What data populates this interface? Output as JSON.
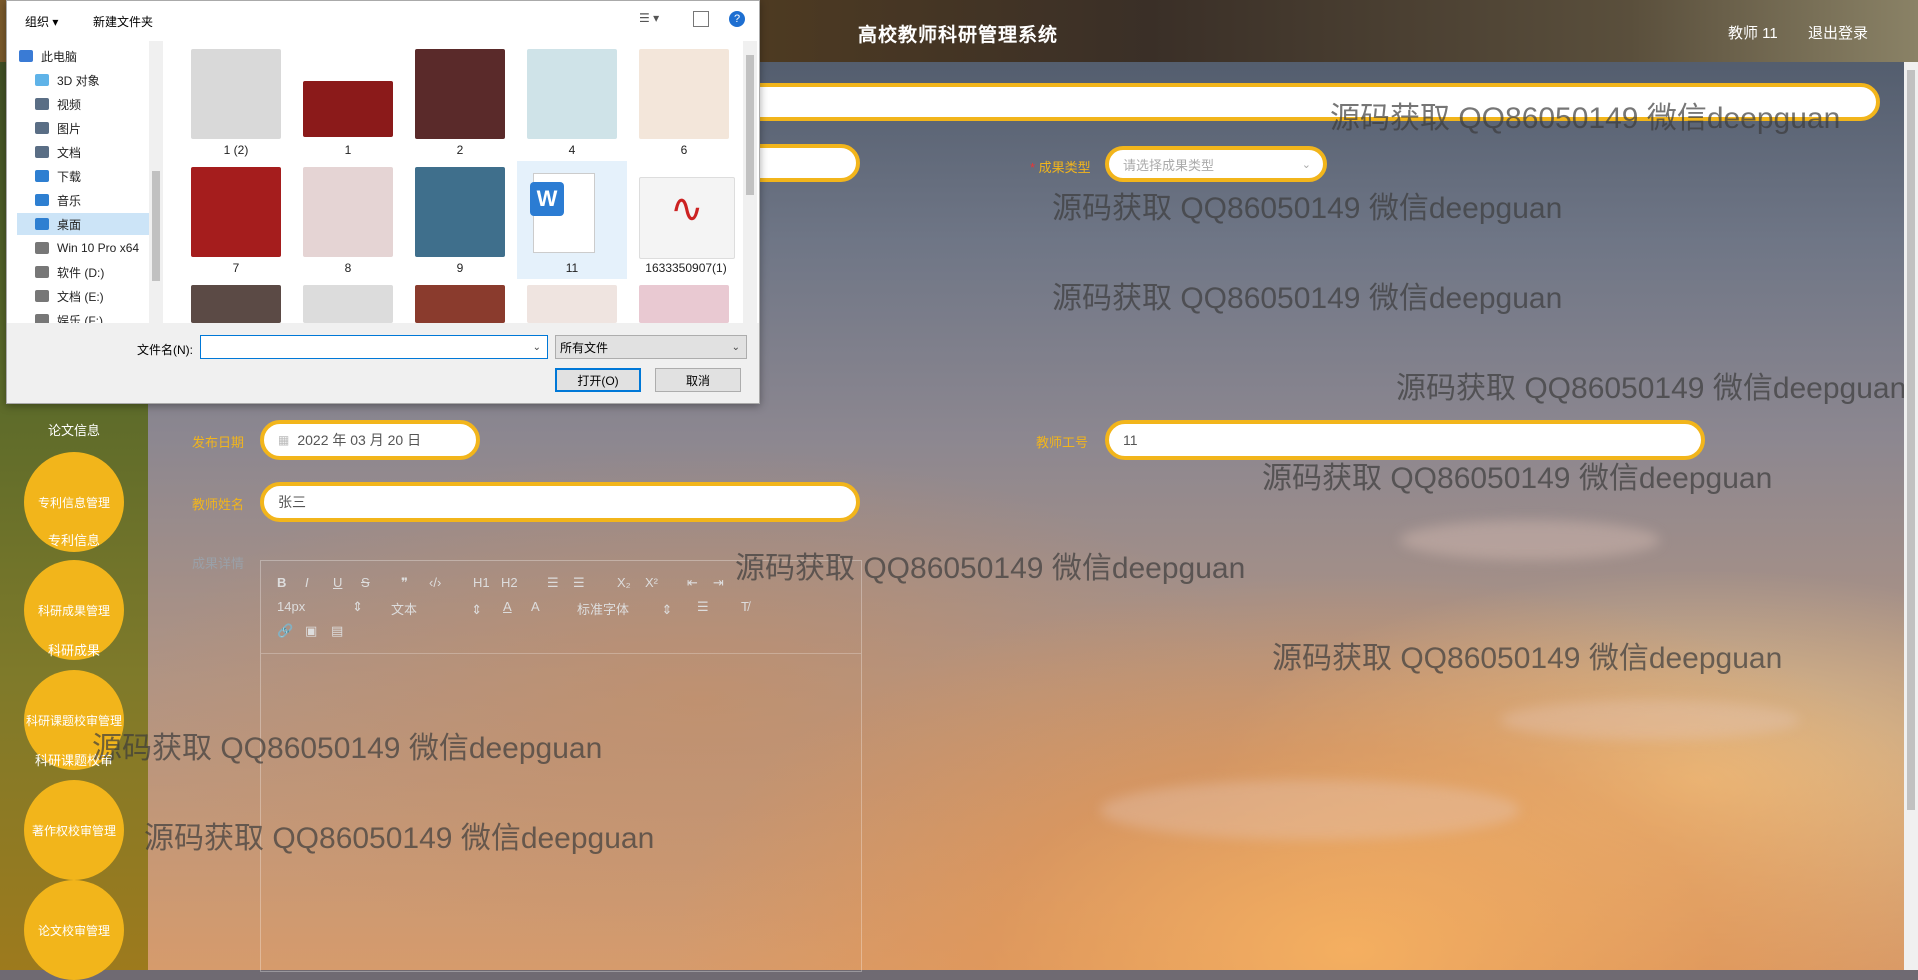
{
  "app": {
    "title": "高校教师科研管理系统",
    "user_label": "教师 11",
    "logout_label": "退出登录"
  },
  "sidebar": {
    "items": [
      {
        "main": "",
        "sub": "论文信息"
      },
      {
        "main": "专利信息管理",
        "sub": "专利信息"
      },
      {
        "main": "科研成果管理",
        "sub": "科研成果"
      },
      {
        "main": "科研课题校审管理",
        "sub": "科研课题校审"
      },
      {
        "main": "著作权校审管理",
        "sub": ""
      },
      {
        "main": "论文校审管理",
        "sub": ""
      }
    ]
  },
  "form": {
    "result_type_label": "成果类型",
    "result_type_placeholder": "请选择成果类型",
    "publish_date_label": "发布日期",
    "publish_date_value": "2022 年 03 月 20 日",
    "teacher_id_label": "教师工号",
    "teacher_id_value": "11",
    "teacher_name_label": "教师姓名",
    "teacher_name_value": "张三",
    "detail_label": "成果详情"
  },
  "editor": {
    "font_size": "14px",
    "block_type": "文本",
    "font_family": "标准字体",
    "buttons": [
      "B",
      "I",
      "U",
      "S",
      "❞",
      "‹/›",
      "H1",
      "H2",
      "ol",
      "ul",
      "X₂",
      "X²",
      "outdent",
      "indent",
      "A",
      "A",
      "align",
      "Tx",
      "link",
      "image",
      "video"
    ]
  },
  "watermark": "源码获取 QQ86050149 微信deepguan",
  "dialog": {
    "toolbar": {
      "organize": "组织 ▾",
      "new_folder": "新建文件夹"
    },
    "tree": [
      {
        "label": "此电脑",
        "icon": "computer-icon",
        "color": "#3a7bd5"
      },
      {
        "label": "3D 对象",
        "icon": "cube-icon",
        "color": "#5fb3e8"
      },
      {
        "label": "视频",
        "icon": "video-icon",
        "color": "#5a6e85"
      },
      {
        "label": "图片",
        "icon": "picture-icon",
        "color": "#5a6e85"
      },
      {
        "label": "文档",
        "icon": "document-icon",
        "color": "#5a6e85"
      },
      {
        "label": "下载",
        "icon": "download-icon",
        "color": "#2e7fd1"
      },
      {
        "label": "音乐",
        "icon": "music-icon",
        "color": "#2e7fd1"
      },
      {
        "label": "桌面",
        "icon": "desktop-icon",
        "color": "#2e7fd1",
        "selected": true
      },
      {
        "label": "Win 10 Pro x64",
        "icon": "drive-icon",
        "color": "#777"
      },
      {
        "label": "软件 (D:)",
        "icon": "drive-icon",
        "color": "#777"
      },
      {
        "label": "文档 (E:)",
        "icon": "drive-icon",
        "color": "#777"
      },
      {
        "label": "娱乐 (F:)",
        "icon": "drive-icon",
        "color": "#777"
      }
    ],
    "files": [
      {
        "name": "1 (2)",
        "color": "#d9d9d9"
      },
      {
        "name": "1",
        "color": "#8b1a1a"
      },
      {
        "name": "2",
        "color": "#5a2a2a"
      },
      {
        "name": "4",
        "color": "#cfe3e8"
      },
      {
        "name": "6",
        "color": "#f3e6da"
      },
      {
        "name": "7",
        "color": "#a51d1d"
      },
      {
        "name": "8",
        "color": "#e5d4d4"
      },
      {
        "name": "9",
        "color": "#3f6f8c"
      },
      {
        "name": "11",
        "color": "#ffffff"
      },
      {
        "name": "1633350907(1)",
        "color": "#f4f4f4"
      }
    ],
    "filename_label": "文件名(N):",
    "filename_value": "",
    "filetype_value": "所有文件",
    "open_label": "打开(O)",
    "cancel_label": "取消"
  }
}
